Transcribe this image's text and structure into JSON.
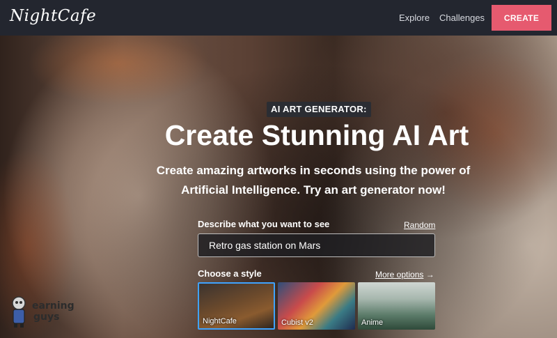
{
  "nav": {
    "logo": "NightCafe",
    "links": [
      "Explore",
      "Challenges"
    ],
    "create_label": "CREATE",
    "accent": "#e65a6f"
  },
  "hero": {
    "badge": "AI ART GENERATOR:",
    "headline": "Create Stunning AI Art",
    "subtitle": "Create amazing artworks in seconds using the power of Artificial Intelligence. Try an art generator now!"
  },
  "prompt": {
    "label": "Describe what you want to see",
    "random_label": "Random",
    "value": "Retro gas station on Mars"
  },
  "styles": {
    "label": "Choose a style",
    "more_label": "More options",
    "more_arrow": "→",
    "items": [
      {
        "name": "NightCafe",
        "selected": true
      },
      {
        "name": "Cubist v2",
        "selected": false
      },
      {
        "name": "Anime",
        "selected": false
      }
    ]
  },
  "watermark": {
    "line1": "earning",
    "line2": "guys"
  }
}
